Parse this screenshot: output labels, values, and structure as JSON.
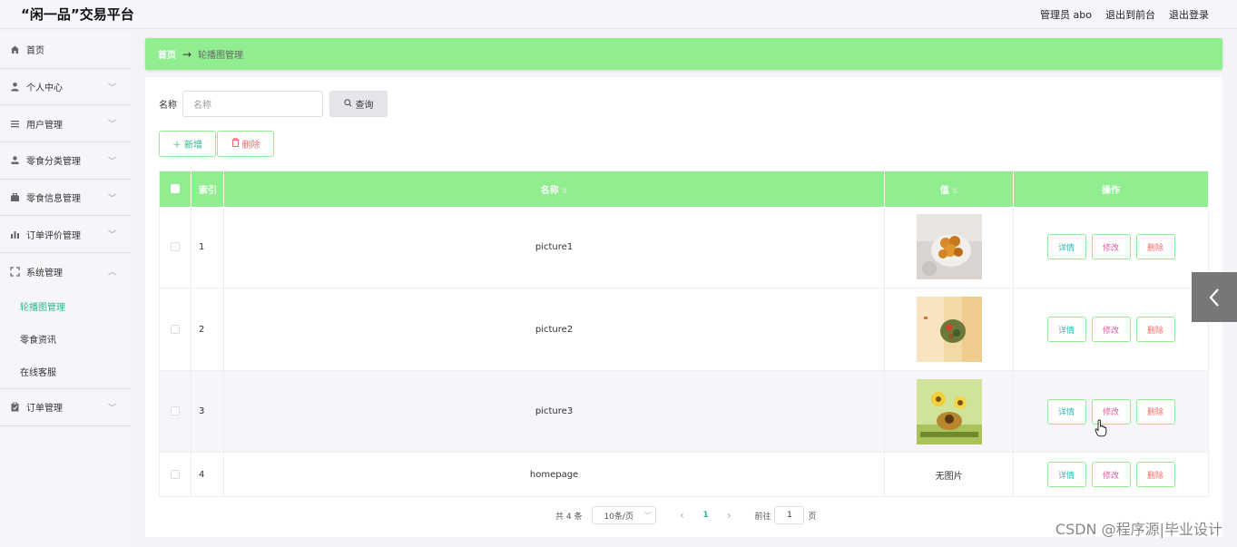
{
  "header": {
    "logo": "“闲一品”交易平台",
    "admin": "管理员 abo",
    "to_front": "退出到前台",
    "logout": "退出登录"
  },
  "sidebar": {
    "items": [
      {
        "label": "首页",
        "icon": "home-icon"
      },
      {
        "label": "个人中心",
        "icon": "user-icon"
      },
      {
        "label": "用户管理",
        "icon": "list-icon"
      },
      {
        "label": "零食分类管理",
        "icon": "person-icon"
      },
      {
        "label": "零食信息管理",
        "icon": "briefcase-icon"
      },
      {
        "label": "订单评价管理",
        "icon": "bar-chart-icon"
      },
      {
        "label": "系统管理",
        "icon": "fullscreen-icon"
      }
    ],
    "sub_items": [
      "轮播图管理",
      "零食资讯",
      "在线客服"
    ],
    "last_item": {
      "label": "订单管理",
      "icon": "clipboard-icon"
    }
  },
  "breadcrumb": {
    "home": "首页",
    "arrow": "→",
    "current": "轮播图管理"
  },
  "search": {
    "label": "名称",
    "placeholder": "名称",
    "button": "查询"
  },
  "actions": {
    "add": "新增",
    "delete": "删除"
  },
  "table": {
    "headers": {
      "index": "索引",
      "name": "名称",
      "value": "值",
      "ops": "操作"
    },
    "rows": [
      {
        "index": "1",
        "name": "picture1",
        "value": "image",
        "image": "fried-snack"
      },
      {
        "index": "2",
        "name": "picture2",
        "value": "image",
        "image": "salad-bowl"
      },
      {
        "index": "3",
        "name": "picture3",
        "value": "image",
        "image": "sunflower-dish"
      },
      {
        "index": "4",
        "name": "homepage",
        "value": "无图片",
        "image": ""
      }
    ],
    "op_labels": {
      "detail": "详情",
      "edit": "修改",
      "remove": "删除"
    }
  },
  "pagination": {
    "total": "共 4 条",
    "page_size": "10条/页",
    "current_page": "1",
    "goto_label": "前往",
    "goto_value": "1",
    "page_suffix": "页"
  },
  "watermark": "CSDN @程序源|毕业设计",
  "colors": {
    "accent": "#90ee90",
    "active_text": "#2fb38e",
    "danger": "#f56c6c"
  }
}
